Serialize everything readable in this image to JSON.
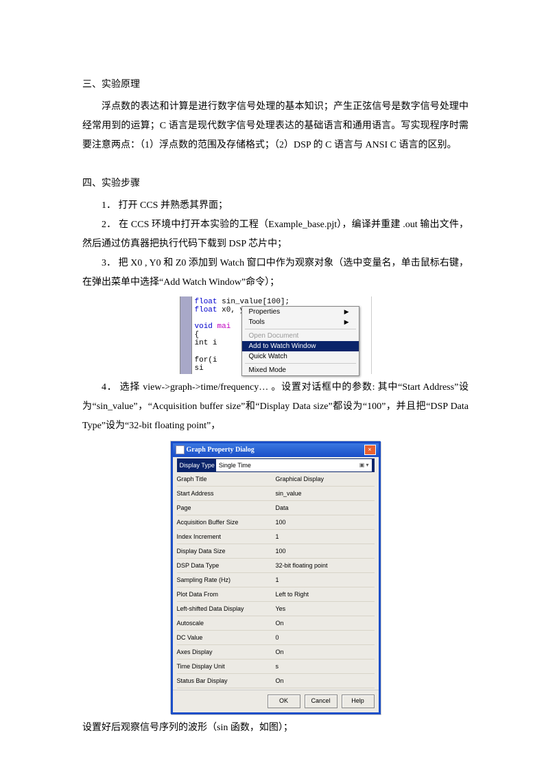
{
  "section3": {
    "title": "三、实验原理",
    "para": "浮点数的表达和计算是进行数字信号处理的基本知识；产生正弦信号是数字信号处理中经常用到的运算；C 语言是现代数字信号处理表达的基础语言和通用语言。写实现程序时需要注意两点：（1）浮点数的范围及存储格式；（2）DSP 的 C 语言与 ANSI C 语言的区别。"
  },
  "section4": {
    "title": "四、实验步骤",
    "s1": "1．  打开 CCS  并熟悉其界面；",
    "s2": "2．  在 CCS 环境中打开本实验的工程（Example_base.pjt），编译并重建  .out  输出文件，然后通过仿真器把执行代码下载到 DSP  芯片中；",
    "s3": "3．  把 X0 , Y0  和 Z0 添加到 Watch 窗口中作为观察对象（选中变量名，单击鼠标右键，在弹出菜单中选择“Add Watch Window”命令）；",
    "s4": "4．  选择 view->graph->time/frequency…   。设置对话框中的参数:  其中“Start Address”设为“sin_value”，“Acquisition buffer size”和“Display Data size”都设为“100”，并且把“DSP Data Type”设为“32-bit floating point”，",
    "tail": "设置好后观察信号序列的波形（sin 函数，如图）；"
  },
  "code": {
    "l1a": "float",
    "l1b": "  sin_value[100];",
    "l2a": "float",
    "l2b": "  x0, y0, z0;",
    "l4a": "void",
    "l4b": " mai",
    "l5": "{",
    "l6": "  int i",
    "l8": "  for(i",
    "l9": "    si"
  },
  "menu": {
    "properties": "Properties",
    "tools": "Tools",
    "opendoc": "Open Document",
    "addwatch": "Add to Watch Window",
    "quickwatch": "Quick Watch",
    "mixed": "Mixed Mode"
  },
  "dialog": {
    "title": "Graph Property Dialog",
    "rows": [
      {
        "k": "Display Type",
        "v": "Single Time"
      },
      {
        "k": "Graph Title",
        "v": "Graphical Display"
      },
      {
        "k": "Start Address",
        "v": "sin_value"
      },
      {
        "k": "Page",
        "v": "Data"
      },
      {
        "k": "Acquisition Buffer Size",
        "v": "100"
      },
      {
        "k": "Index Increment",
        "v": "1"
      },
      {
        "k": "Display Data Size",
        "v": "100"
      },
      {
        "k": "DSP Data Type",
        "v": "32-bit floating point"
      },
      {
        "k": "Sampling Rate (Hz)",
        "v": "1"
      },
      {
        "k": "Plot Data From",
        "v": "Left to Right"
      },
      {
        "k": "Left-shifted Data Display",
        "v": "Yes"
      },
      {
        "k": "Autoscale",
        "v": "On"
      },
      {
        "k": "DC Value",
        "v": "0"
      },
      {
        "k": "Axes Display",
        "v": "On"
      },
      {
        "k": "Time Display Unit",
        "v": "s"
      },
      {
        "k": "Status Bar Display",
        "v": "On"
      }
    ],
    "ok": "OK",
    "cancel": "Cancel",
    "help": "Help"
  }
}
